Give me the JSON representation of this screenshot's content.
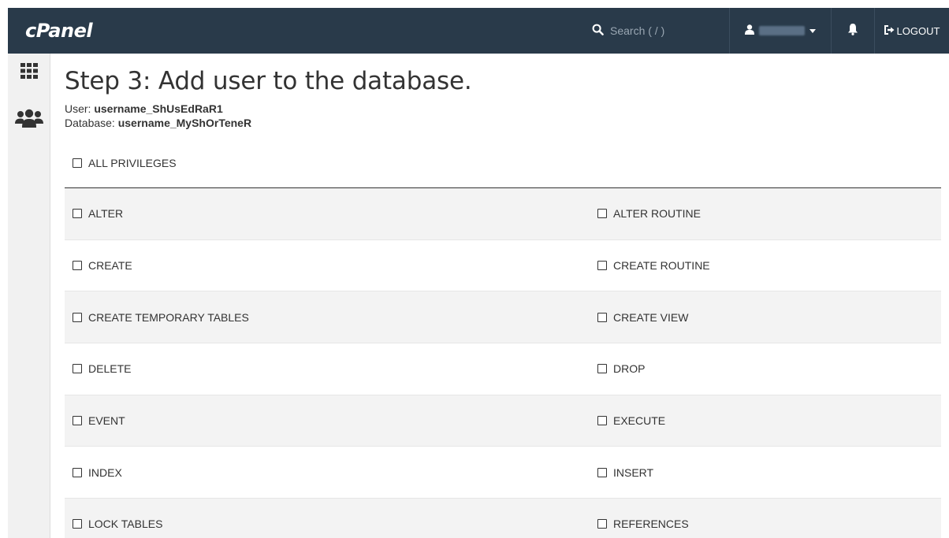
{
  "app": {
    "logo": "cPanel"
  },
  "navbar": {
    "search_placeholder": "Search ( / )",
    "user_name": "username",
    "logout_label": "LOGOUT"
  },
  "sidebar": {
    "items": [
      {
        "icon": "grid-icon"
      },
      {
        "icon": "users-icon"
      }
    ]
  },
  "page": {
    "title": "Step 3: Add user to the database.",
    "user_label": "User:",
    "user_value": "username_ShUsEdRaR1",
    "database_label": "Database:",
    "database_value": "username_MyShOrTeneR",
    "all_privileges_label": "ALL PRIVILEGES"
  },
  "privileges": [
    [
      "ALTER",
      "ALTER ROUTINE"
    ],
    [
      "CREATE",
      "CREATE ROUTINE"
    ],
    [
      "CREATE TEMPORARY TABLES",
      "CREATE VIEW"
    ],
    [
      "DELETE",
      "DROP"
    ],
    [
      "EVENT",
      "EXECUTE"
    ],
    [
      "INDEX",
      "INSERT"
    ],
    [
      "LOCK TABLES",
      "REFERENCES"
    ]
  ],
  "colors": {
    "navbar": "#293a4a",
    "sidebar": "#f1f1f1",
    "row_alt": "#f3f3f3"
  }
}
